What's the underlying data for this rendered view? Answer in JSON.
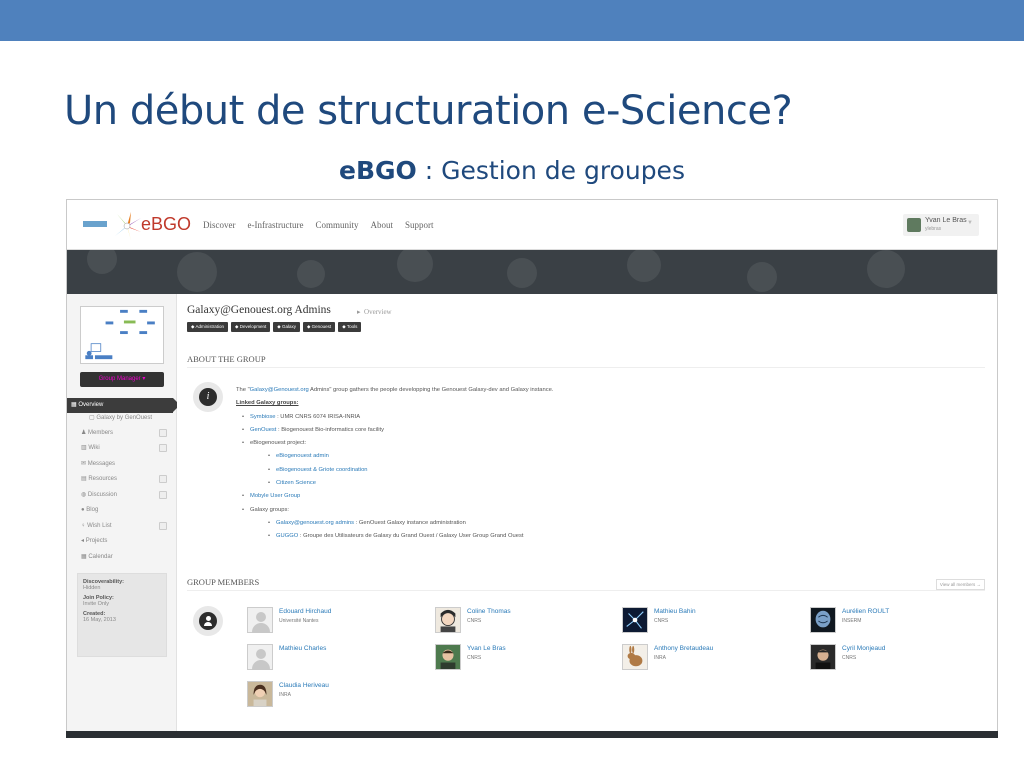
{
  "slide": {
    "title": "Un début de structuration e-Science?",
    "subtitle_bold": "eBGO",
    "subtitle_rest": " : Gestion de groupes"
  },
  "nav": {
    "logo_text": "eBGO",
    "links": [
      "Discover",
      "e-Infrastructure",
      "Community",
      "About",
      "Support"
    ],
    "user_name": "Yvan Le Bras",
    "user_sub": "ylebras"
  },
  "group": {
    "title": "Galaxy@Genouest.org Admins",
    "breadcrumb": "Overview",
    "tags": [
      "Administration",
      "Development",
      "Galaxy",
      "Genouest",
      "Tools"
    ],
    "manager_button": "Group Manager"
  },
  "sidebar": {
    "items": [
      {
        "label": "Overview"
      },
      {
        "label": "Galaxy by GenOuest"
      },
      {
        "label": "Members"
      },
      {
        "label": "Wiki"
      },
      {
        "label": "Messages"
      },
      {
        "label": "Resources"
      },
      {
        "label": "Discussion"
      },
      {
        "label": "Blog"
      },
      {
        "label": "Wish List"
      },
      {
        "label": "Projects"
      },
      {
        "label": "Calendar"
      }
    ],
    "info": {
      "discoverability_label": "Discoverability:",
      "discoverability_value": "Hidden",
      "join_label": "Join Policy:",
      "join_value": "Invite Only",
      "created_label": "Created:",
      "created_value": "16 May, 2013"
    }
  },
  "about": {
    "heading": "ABOUT THE GROUP",
    "intro_pre": "The \"",
    "intro_link": "Galaxy@Genouest.org",
    "intro_post": " Admins\" group gathers the people developping the Genouest Galaxy-dev and Galaxy instance.",
    "linked_heading": "Linked Galaxy groups:",
    "symbiose_link": "Symbiose",
    "symbiose_text": " : UMR CNRS 6074 IRISA-INRIA",
    "genouest_link": "GenOuest",
    "genouest_text": " : Biogenouest Bio-informatics core facility",
    "ebio_project": "eBiogenouest project:",
    "ebio_admin": "eBiogenouest admin",
    "ebio_griote": "eBiogenouest & Griote coordination",
    "citizen": "Citizen Science",
    "mobyle": "Mobyle User Group",
    "galaxy_groups": "Galaxy groups:",
    "gg_admins_link": "Galaxy@genouest.org admins",
    "gg_admins_text": " : GenOuest Galaxy instance administration",
    "guggo_link": "GUGGO",
    "guggo_text": " : Groupe des Utilisateurs de Galaxy du Grand Ouest / Galaxy User Group Grand Ouest"
  },
  "members": {
    "heading": "GROUP MEMBERS",
    "view_all": "View all members →",
    "list": [
      {
        "name": "Edouard Hirchaud",
        "affiliation": "Université Nantes",
        "photo": "blank"
      },
      {
        "name": "Coline Thomas",
        "affiliation": "CNRS",
        "photo": "cartoon"
      },
      {
        "name": "Mathieu Bahin",
        "affiliation": "CNRS",
        "photo": "neuron"
      },
      {
        "name": "Aurélien ROULT",
        "affiliation": "INSERM",
        "photo": "brain"
      },
      {
        "name": "Mathieu Charles",
        "affiliation": "",
        "photo": "blank"
      },
      {
        "name": "Yvan Le Bras",
        "affiliation": "CNRS",
        "photo": "person-green"
      },
      {
        "name": "Anthony Bretaudeau",
        "affiliation": "INRA",
        "photo": "rabbit"
      },
      {
        "name": "Cyril Monjeaud",
        "affiliation": "CNRS",
        "photo": "person-dark"
      },
      {
        "name": "Claudia Heriveau",
        "affiliation": "INRA",
        "photo": "person-light"
      }
    ]
  },
  "colors": {
    "slide_bar": "#4f81bd",
    "slide_title": "#1f497d",
    "link": "#2a7ab8",
    "banner": "#3a4045"
  }
}
